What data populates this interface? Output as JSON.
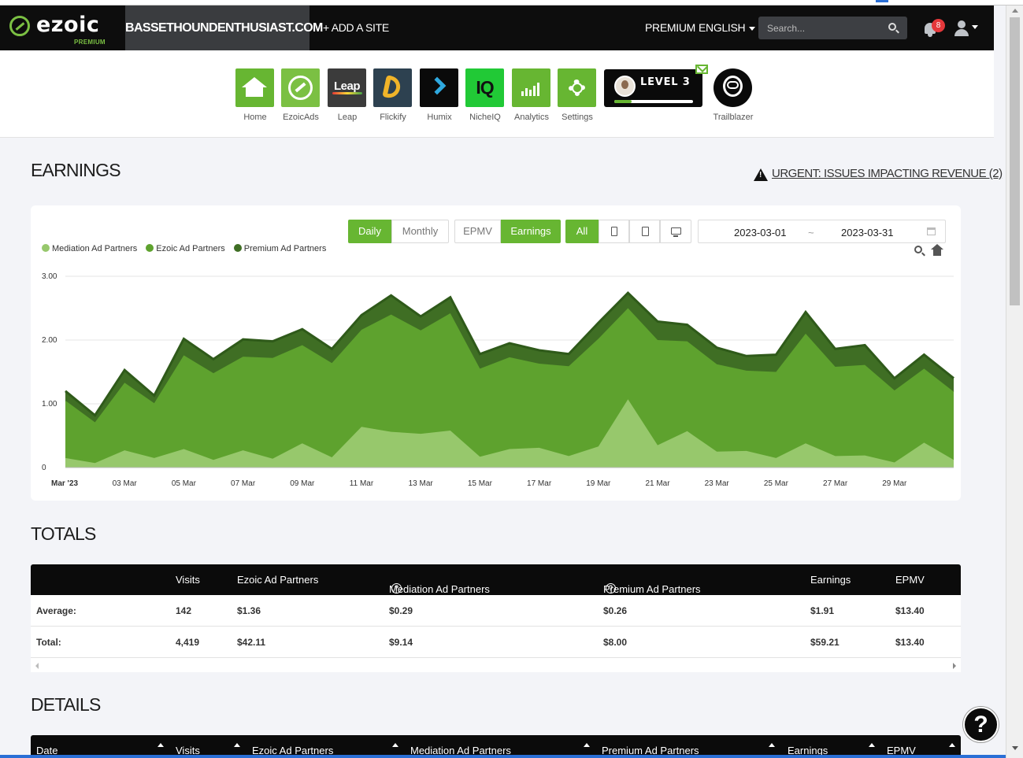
{
  "header": {
    "logo_text": "ezoic",
    "logo_sub": "PREMIUM",
    "site": "BASSETHOUNDENTHUSIAST.COM",
    "add_site": "+ ADD A SITE",
    "premium": "PREMIUM",
    "language": "ENGLISH",
    "search_placeholder": "Search...",
    "notifications": "8"
  },
  "apps": [
    {
      "label": "Home",
      "icon": "home-icon"
    },
    {
      "label": "EzoicAds",
      "icon": "ezoicads-icon"
    },
    {
      "label": "Leap",
      "icon": "leap-icon",
      "tile_text": "Leap"
    },
    {
      "label": "Flickify",
      "icon": "flickify-icon"
    },
    {
      "label": "Humix",
      "icon": "humix-icon"
    },
    {
      "label": "NicheIQ",
      "icon": "nicheiq-icon",
      "tile_text": "IQ"
    },
    {
      "label": "Analytics",
      "icon": "analytics-icon"
    },
    {
      "label": "Settings",
      "icon": "gear-icon"
    }
  ],
  "level": {
    "text": "LEVEL 3",
    "progress": 0.22
  },
  "trailblazer": {
    "label": "Trailblazer"
  },
  "earnings": {
    "title": "EARNINGS",
    "urgent": "URGENT: ISSUES IMPACTING REVENUE (2)"
  },
  "controls": {
    "daily": "Daily",
    "monthly": "Monthly",
    "epmv": "EPMV",
    "earnings": "Earnings",
    "all": "All",
    "date_from": "2023-03-01",
    "date_sep": "~",
    "date_to": "2023-03-31"
  },
  "chart_data": {
    "type": "area",
    "stacked": true,
    "x": [
      "2023-03-01",
      "2023-03-02",
      "2023-03-03",
      "2023-03-04",
      "2023-03-05",
      "2023-03-06",
      "2023-03-07",
      "2023-03-08",
      "2023-03-09",
      "2023-03-10",
      "2023-03-11",
      "2023-03-12",
      "2023-03-13",
      "2023-03-14",
      "2023-03-15",
      "2023-03-16",
      "2023-03-17",
      "2023-03-18",
      "2023-03-19",
      "2023-03-20",
      "2023-03-21",
      "2023-03-22",
      "2023-03-23",
      "2023-03-24",
      "2023-03-25",
      "2023-03-26",
      "2023-03-27",
      "2023-03-28",
      "2023-03-29",
      "2023-03-30",
      "2023-03-31"
    ],
    "x_tick_labels": [
      "Mar '23",
      "03 Mar",
      "05 Mar",
      "07 Mar",
      "09 Mar",
      "11 Mar",
      "13 Mar",
      "15 Mar",
      "17 Mar",
      "19 Mar",
      "21 Mar",
      "23 Mar",
      "25 Mar",
      "27 Mar",
      "29 Mar"
    ],
    "y_ticks": [
      "0",
      "1.00",
      "2.00",
      "3.00"
    ],
    "ylim": [
      0,
      3
    ],
    "grid": true,
    "legend_position": "top-left",
    "series": [
      {
        "name": "Mediation Ad Partners",
        "color": "#97c86c",
        "values": [
          0.15,
          0.07,
          0.27,
          0.15,
          0.29,
          0.12,
          0.27,
          0.14,
          0.38,
          0.16,
          0.64,
          0.56,
          0.53,
          0.58,
          0.17,
          0.29,
          0.31,
          0.18,
          0.33,
          1.07,
          0.35,
          0.57,
          0.25,
          0.26,
          0.15,
          0.38,
          0.18,
          0.19,
          0.08,
          0.39,
          0.12
        ]
      },
      {
        "name": "Ezoic Ad Partners",
        "color": "#5ea22e",
        "values": [
          0.9,
          0.64,
          1.06,
          0.86,
          1.47,
          1.36,
          1.47,
          1.58,
          1.54,
          1.48,
          1.52,
          1.84,
          1.62,
          1.84,
          1.38,
          1.44,
          1.32,
          1.41,
          1.69,
          1.43,
          1.65,
          1.41,
          1.37,
          1.26,
          1.35,
          1.72,
          1.4,
          1.42,
          1.13,
          1.16,
          1.07
        ]
      },
      {
        "name": "Premium Ad Partners",
        "color": "#3f6e24",
        "values": [
          0.15,
          0.11,
          0.2,
          0.12,
          0.26,
          0.22,
          0.27,
          0.26,
          0.25,
          0.22,
          0.23,
          0.3,
          0.22,
          0.25,
          0.23,
          0.22,
          0.21,
          0.19,
          0.25,
          0.24,
          0.29,
          0.26,
          0.26,
          0.23,
          0.27,
          0.34,
          0.28,
          0.31,
          0.19,
          0.22,
          0.21
        ]
      }
    ]
  },
  "totals": {
    "title": "TOTALS",
    "columns": [
      "",
      "Visits",
      "Ezoic Ad Partners",
      "Mediation Ad Partners",
      "Premium Ad Partners",
      "Earnings",
      "EPMV"
    ],
    "rows": [
      [
        "Average:",
        "142",
        "$1.36",
        "$0.29",
        "$0.26",
        "$1.91",
        "$13.40"
      ],
      [
        "Total:",
        "4,419",
        "$42.11",
        "$9.14",
        "$8.00",
        "$59.21",
        "$13.40"
      ]
    ]
  },
  "details": {
    "title": "DETAILS",
    "columns": [
      "Date",
      "Visits",
      "Ezoic Ad Partners",
      "Mediation Ad Partners",
      "Premium Ad Partners",
      "Earnings",
      "EPMV"
    ]
  },
  "help": "?"
}
